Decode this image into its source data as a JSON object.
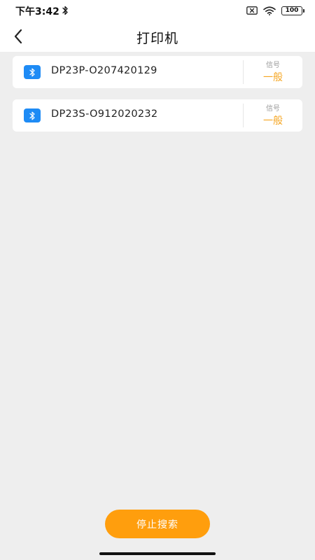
{
  "status_bar": {
    "time": "下午3:42",
    "battery": "100",
    "icons": [
      "bluetooth-icon",
      "no-sim-icon",
      "wifi-icon",
      "battery-icon"
    ]
  },
  "nav": {
    "title": "打印机",
    "back_icon": "chevron-left-icon"
  },
  "devices": [
    {
      "name": "DP23P-O207420129",
      "signal_label": "信号",
      "signal_value": "一般",
      "icon": "bluetooth-icon"
    },
    {
      "name": "DP23S-O912020232",
      "signal_label": "信号",
      "signal_value": "一般",
      "icon": "bluetooth-icon"
    }
  ],
  "footer": {
    "stop_button_label": "停止搜索"
  },
  "colors": {
    "accent": "#ff9e0d",
    "signal_text": "#f5a623",
    "bluetooth_badge": "#1e8bf5",
    "background": "#eeeeee"
  }
}
